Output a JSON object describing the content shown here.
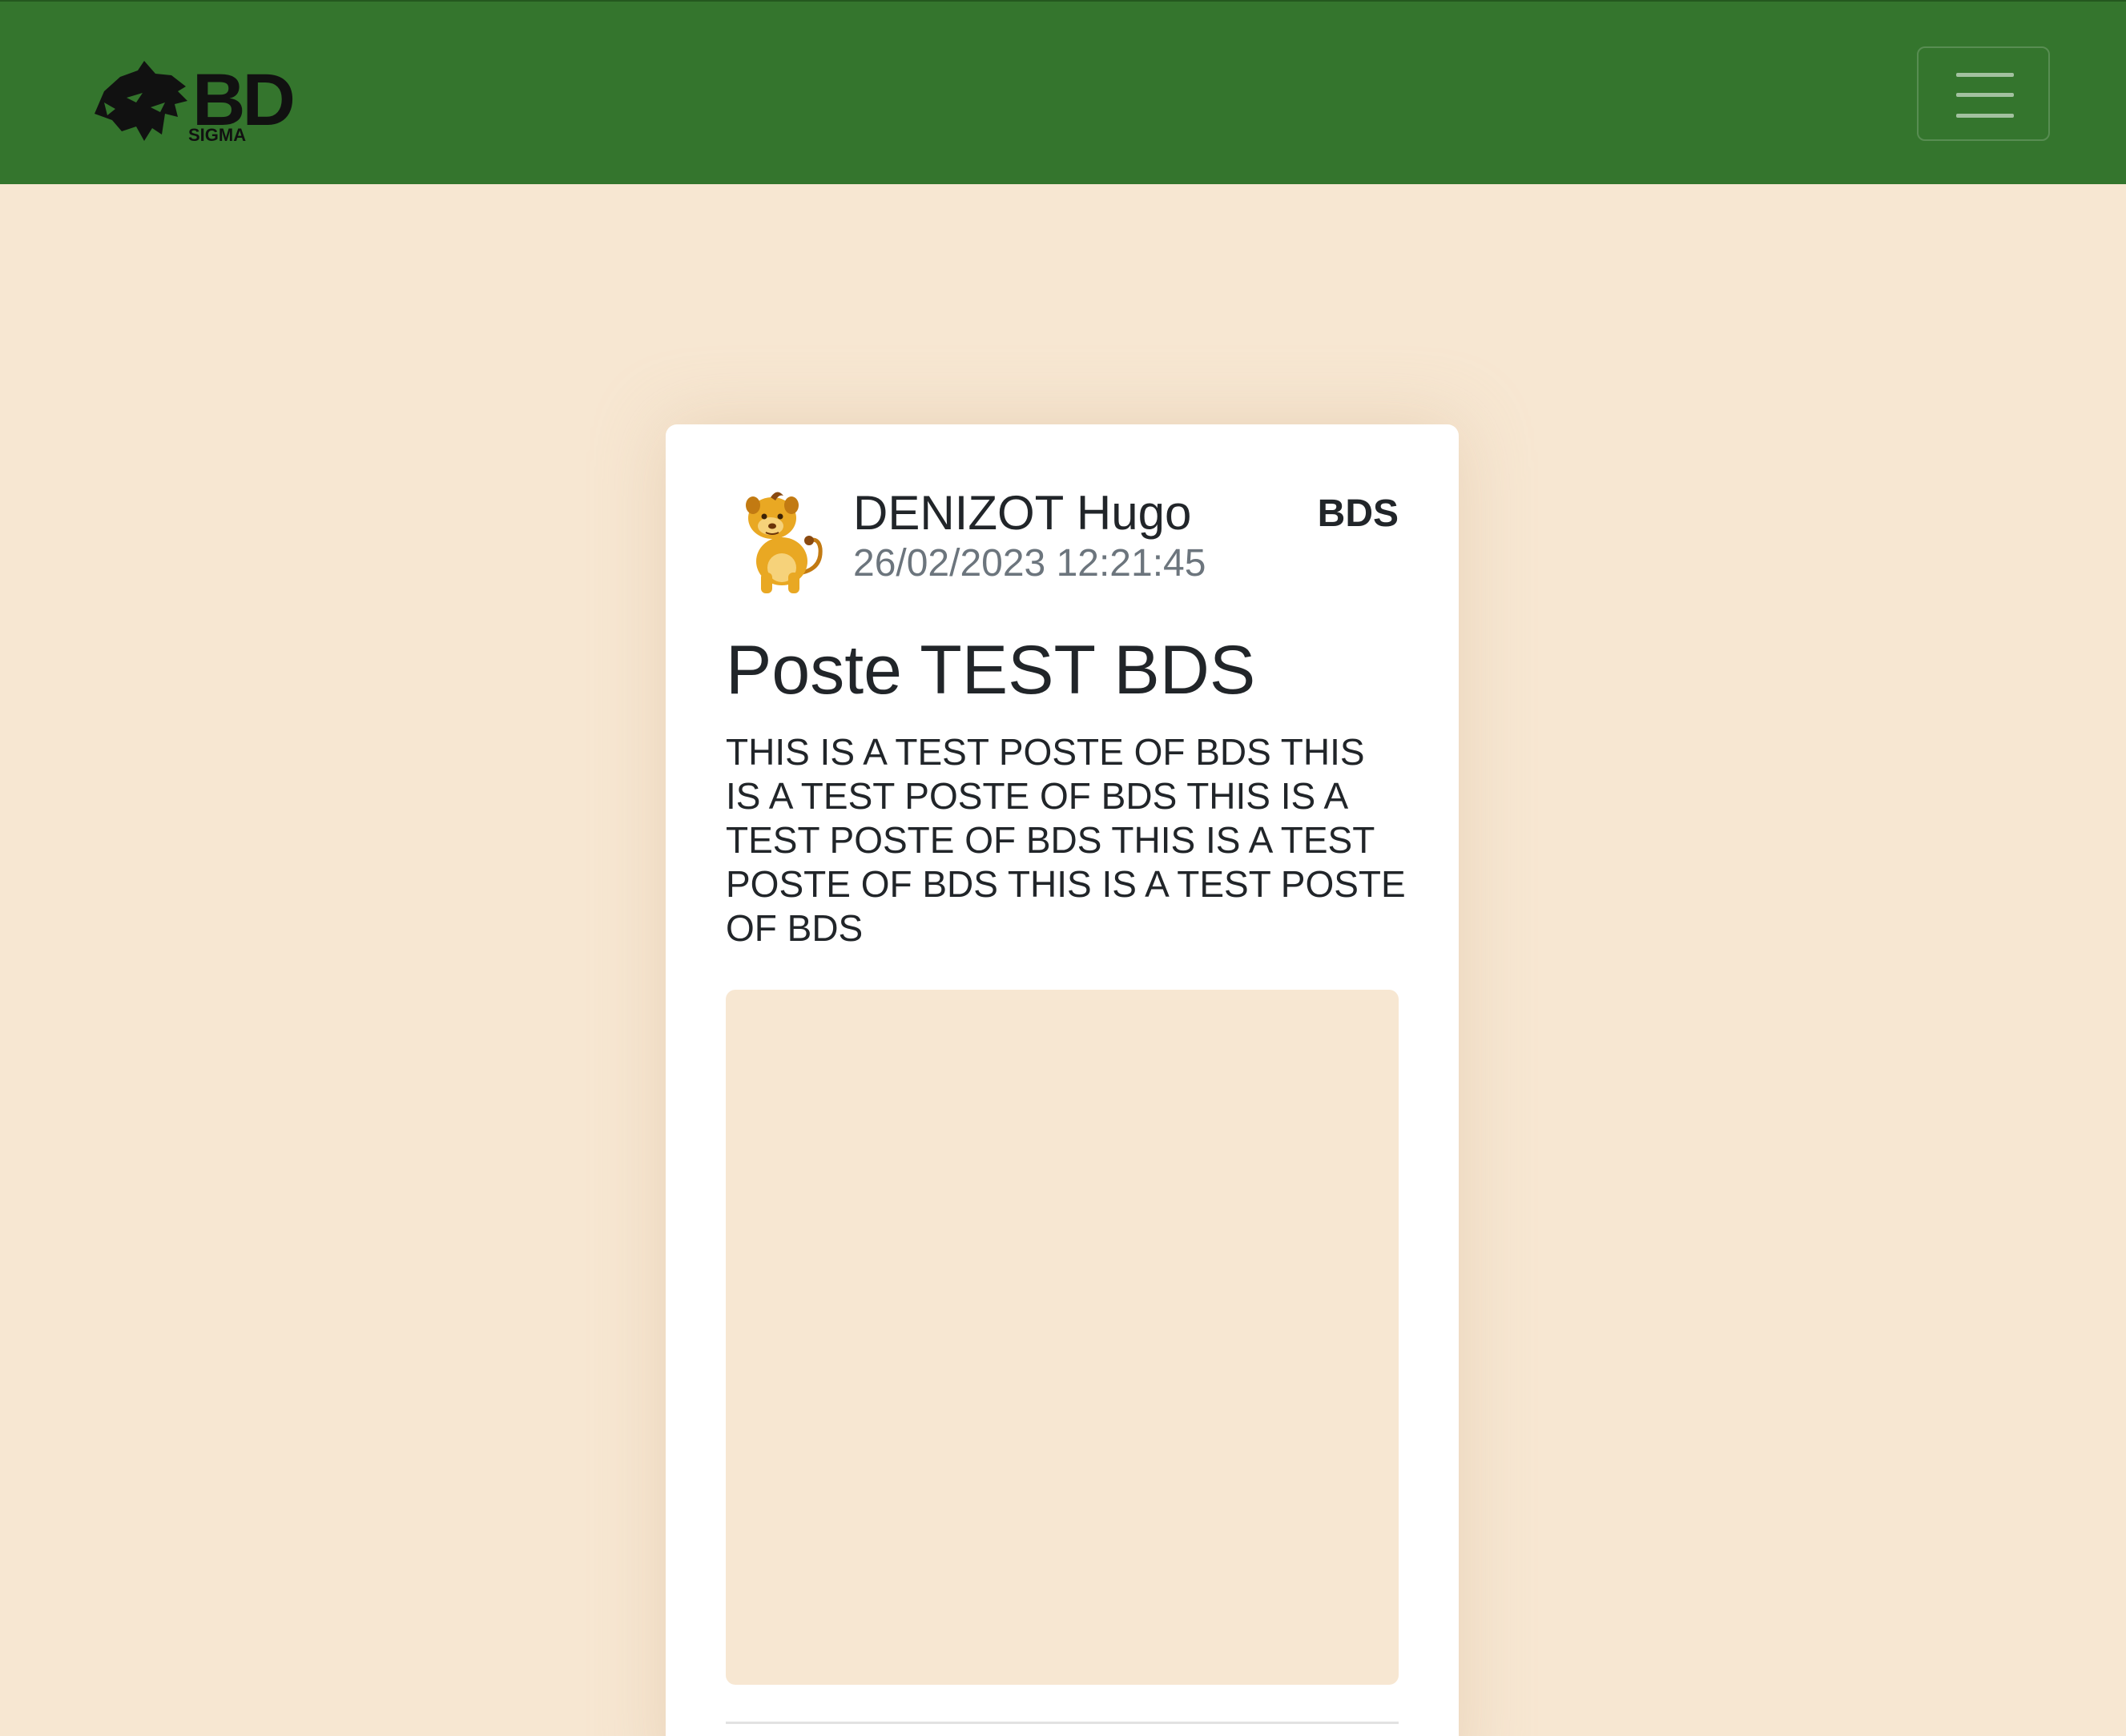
{
  "navbar": {
    "logo_text": "BDE",
    "logo_subtext": "SIGMA",
    "menu_toggle_icon": "hamburger-icon"
  },
  "post": {
    "avatar_icon": "lion-cub-avatar",
    "author": "DENIZOT Hugo",
    "timestamp": "26/02/2023 12:21:45",
    "tag": "BDS",
    "title": "Poste TEST BDS",
    "body": "THIS IS A TEST POSTE OF BDS THIS IS A TEST POSTE OF BDS THIS IS A TEST POSTE OF BDS THIS IS A TEST POSTE OF BDS THIS IS A TEST POSTE OF BDS"
  },
  "colors": {
    "navbar_bg": "#34752d",
    "page_bg": "#f7e7d2",
    "card_bg": "#ffffff",
    "muted_text": "#6c757d"
  }
}
